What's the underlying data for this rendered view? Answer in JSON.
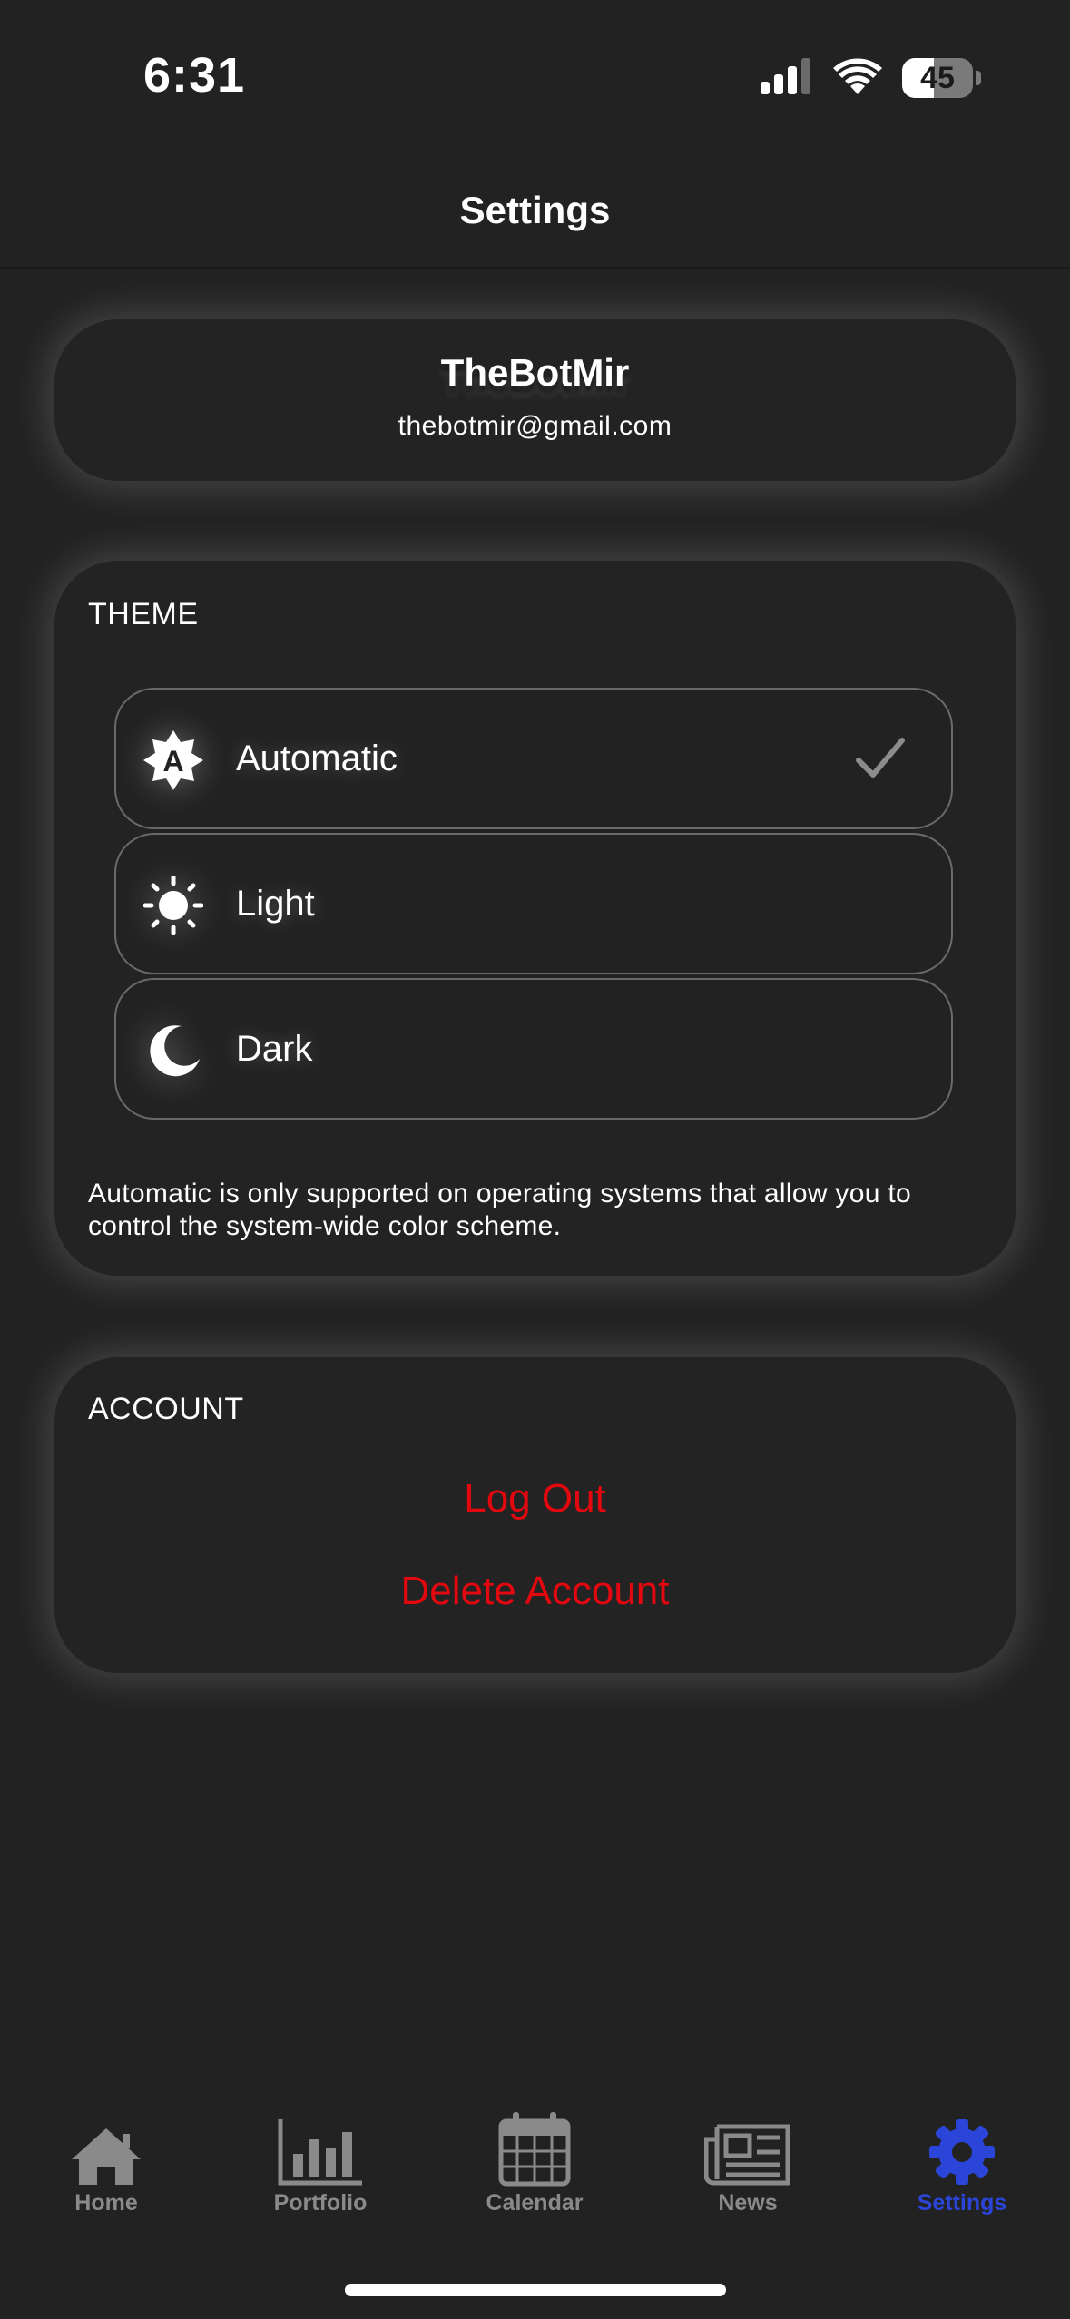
{
  "status_bar": {
    "time": "6:31",
    "battery": "45",
    "battery_level": 0.45,
    "icons": [
      "signal-icon",
      "wifi-icon",
      "battery-icon"
    ]
  },
  "header": {
    "title": "Settings"
  },
  "profile": {
    "name": "TheBotMir",
    "email": "thebotmir@gmail.com"
  },
  "theme": {
    "section_label": "THEME",
    "options": [
      {
        "label": "Automatic",
        "icon": "auto-theme-icon",
        "selected": true
      },
      {
        "label": "Light",
        "icon": "sun-icon",
        "selected": false
      },
      {
        "label": "Dark",
        "icon": "moon-icon",
        "selected": false
      }
    ],
    "note": "Automatic is only supported on operating systems that allow you to control the system-wide color scheme."
  },
  "account": {
    "section_label": "ACCOUNT",
    "logout_label": "Log Out",
    "delete_label": "Delete Account"
  },
  "tab_bar": {
    "tabs": [
      {
        "label": "Home",
        "icon": "home-icon"
      },
      {
        "label": "Portfolio",
        "icon": "bar-chart-icon"
      },
      {
        "label": "Calendar",
        "icon": "calendar-icon"
      },
      {
        "label": "News",
        "icon": "newspaper-icon"
      },
      {
        "label": "Settings",
        "icon": "gear-icon",
        "active": true
      }
    ]
  },
  "colors": {
    "background": "#222222",
    "card": "#232323",
    "danger": "#e3080f",
    "active_tab": "#2a45d8",
    "inactive_tab": "#8a8a8a"
  }
}
